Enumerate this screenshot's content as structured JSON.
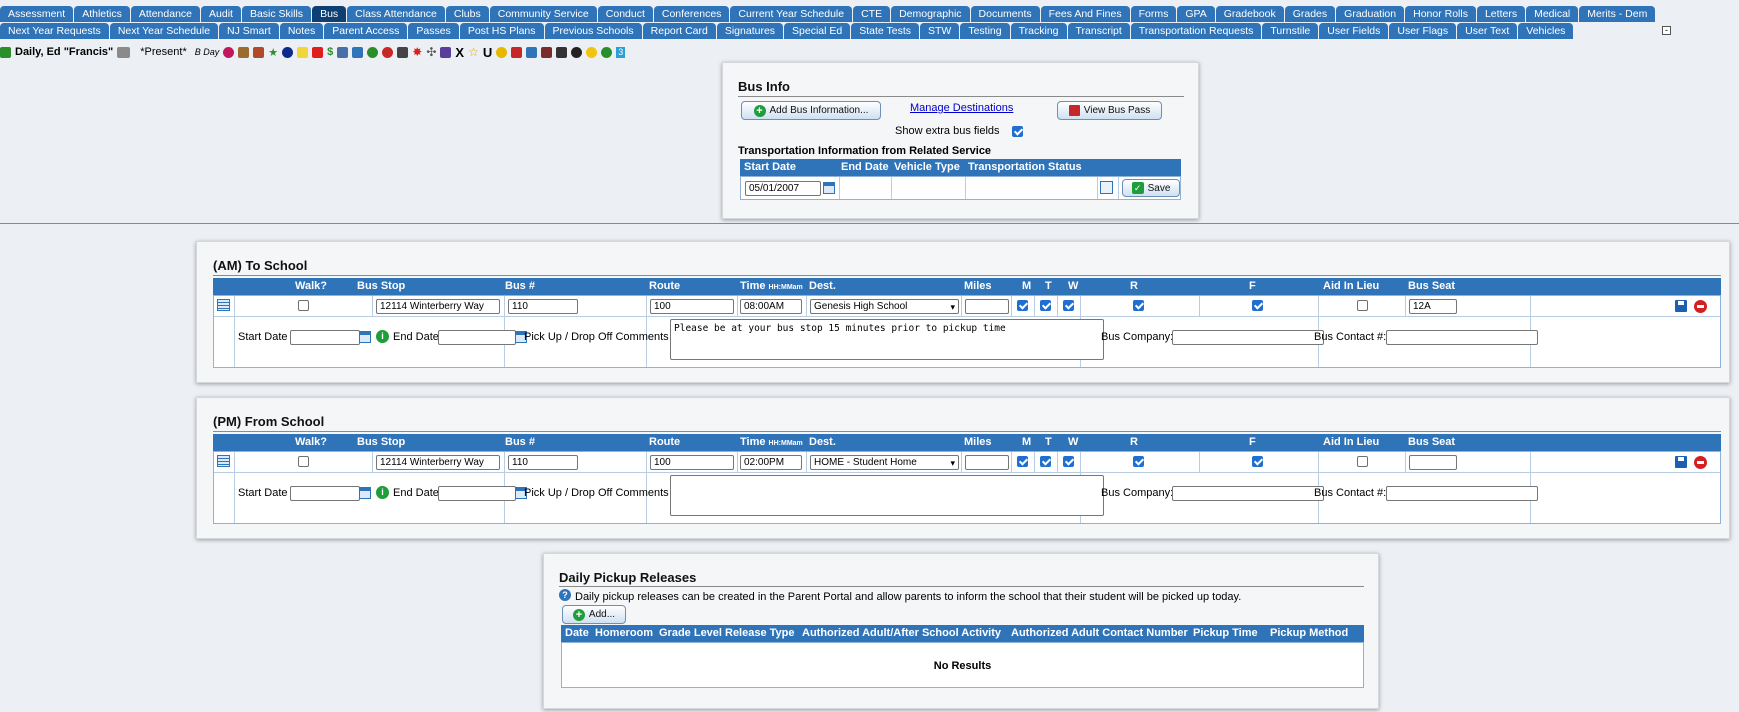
{
  "tabs_row1": [
    "Assessment",
    "Athletics",
    "Attendance",
    "Audit",
    "Basic Skills",
    "Bus",
    "Class Attendance",
    "Clubs",
    "Community Service",
    "Conduct",
    "Conferences",
    "Current Year Schedule",
    "CTE",
    "Demographic",
    "Documents",
    "Fees And Fines",
    "Forms",
    "GPA",
    "Gradebook",
    "Grades",
    "Graduation",
    "Honor Rolls",
    "Letters",
    "Medical",
    "Merits - Dem"
  ],
  "tabs_row2": [
    "Next Year Requests",
    "Next Year Schedule",
    "NJ Smart",
    "Notes",
    "Parent Access",
    "Passes",
    "Post HS Plans",
    "Previous Schools",
    "Report Card",
    "Signatures",
    "Special Ed",
    "State Tests",
    "STW",
    "Testing",
    "Tracking",
    "Transcript",
    "Transportation Requests",
    "Turnstile",
    "User Fields",
    "User Flags",
    "User Text",
    "Vehicles"
  ],
  "active_tab": "Bus",
  "student": {
    "name": "Daily, Ed \"Francis\"",
    "status": "*Present*",
    "day": "B Day",
    "badge_number": "3"
  },
  "bus_info": {
    "title": "Bus Info",
    "add_button": "Add Bus Information...",
    "manage_link": "Manage Destinations",
    "view_pass_button": "View Bus Pass",
    "extra_fields_label": "Show extra bus fields",
    "extra_fields_checked": true,
    "related_title": "Transportation Information from Related Service",
    "columns": [
      "Start Date",
      "End Date",
      "Vehicle Type",
      "Transportation Status"
    ],
    "start_date": "05/01/2007",
    "save_button": "Save"
  },
  "route_columns": {
    "walk": "Walk?",
    "bus_stop": "Bus Stop",
    "bus_num": "Bus #",
    "route": "Route",
    "time": "Time",
    "time_hint": "HH:MMam",
    "dest": "Dest.",
    "miles": "Miles",
    "m": "M",
    "t": "T",
    "w": "W",
    "r": "R",
    "f": "F",
    "aid": "Aid In Lieu",
    "seat": "Bus Seat"
  },
  "row_labels": {
    "start_date": "Start Date",
    "end_date": "End Date",
    "comments": "Pick Up / Drop Off Comments",
    "bus_company": "Bus Company:",
    "bus_contact": "Bus Contact #:"
  },
  "am": {
    "title": "(AM) To School",
    "bus_stop": "12114 Winterberry Way",
    "bus_num": "110",
    "route": "100",
    "time": "08:00AM",
    "dest": "Genesis High School",
    "miles": "",
    "seat": "12A",
    "comments": "Please be at your bus stop 15 minutes prior to pickup time",
    "walk": false,
    "m": true,
    "t": true,
    "w": true,
    "r": true,
    "f": true,
    "aid": false
  },
  "pm": {
    "title": "(PM) From School",
    "bus_stop": "12114 Winterberry Way",
    "bus_num": "110",
    "route": "100",
    "time": "02:00PM",
    "dest": "HOME - Student Home",
    "miles": "",
    "seat": "",
    "comments": "",
    "walk": false,
    "m": true,
    "t": true,
    "w": true,
    "r": true,
    "f": true,
    "aid": false
  },
  "pickup": {
    "title": "Daily Pickup Releases",
    "info": "Daily pickup releases can be created in the Parent Portal and allow parents to inform the school that their student will be picked up today.",
    "add_button": "Add...",
    "columns": [
      "Date",
      "Homeroom",
      "Grade Level",
      "Release Type",
      "Authorized Adult/After School Activity",
      "Authorized Adult Contact Number",
      "Pickup Time",
      "Pickup Method"
    ],
    "empty": "No Results"
  },
  "colors": {
    "tab": "#2f73b8",
    "tab_active": "#0e3f73",
    "header": "#2f73b8",
    "link": "#0000cc"
  }
}
